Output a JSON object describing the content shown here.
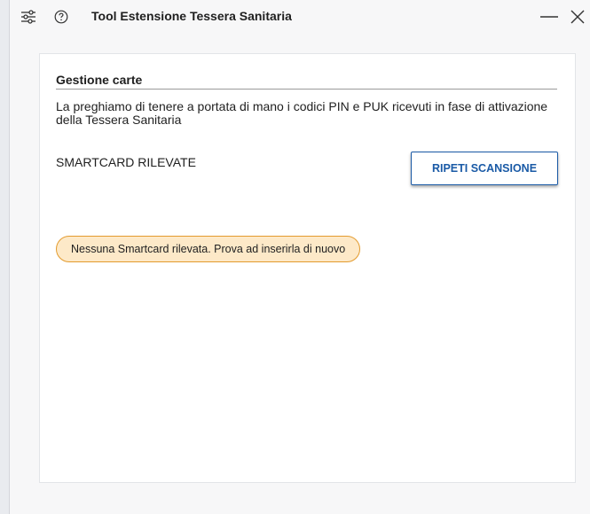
{
  "window": {
    "title": "Tool Estensione Tessera Sanitaria",
    "icons": {
      "settings": "sliders-icon",
      "help": "help-circle-icon",
      "minimize": "minimize-icon",
      "close": "close-icon"
    }
  },
  "panel": {
    "section_title": "Gestione carte",
    "intro": "La preghiamo di tenere a portata di mano i codici PIN e PUK ricevuti in fase di attivazione della Tessera Sanitaria",
    "detected_label": "SMARTCARD RILEVATE",
    "rescan_label": "RIPETI SCANSIONE",
    "notice": "Nessuna Smartcard rilevata. Prova ad inserirla di nuovo"
  },
  "colors": {
    "accent": "#1a5aa6",
    "notice_bg": "#fde9c8",
    "notice_border": "#e39b2e"
  }
}
